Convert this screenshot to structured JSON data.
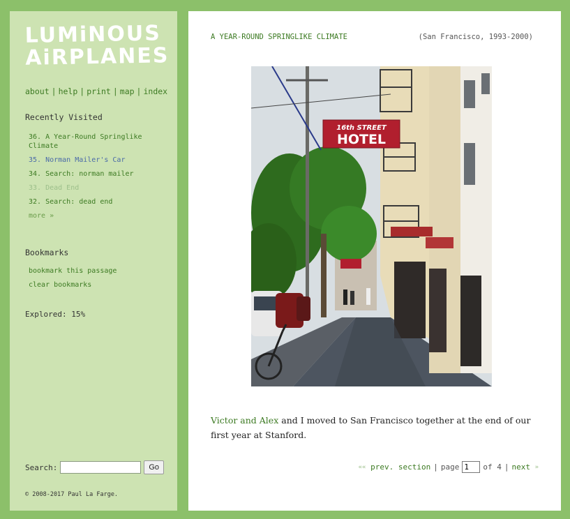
{
  "logo": {
    "line1": "LUMiNOUS",
    "line2": "AiRPLANES"
  },
  "nav": {
    "about": "about",
    "help": "help",
    "print": "print",
    "map": "map",
    "index": "index",
    "separator": "|"
  },
  "recently_visited": {
    "heading": "Recently Visited",
    "items": [
      "36. A Year-Round Springlike Climate",
      "35. Norman Mailer's Car",
      "34. Search: norman mailer",
      "33. Dead End",
      "32. Search: dead end"
    ],
    "more": "more »"
  },
  "bookmarks": {
    "heading": "Bookmarks",
    "bookmark_this": "bookmark this passage",
    "clear": "clear bookmarks"
  },
  "explored": "Explored: 15%",
  "search": {
    "label": "Search:",
    "value": "",
    "button": "Go"
  },
  "copyright": "© 2008-2017 Paul La Farge.",
  "section": {
    "title": "A YEAR-ROUND SPRINGLIKE CLIMATE",
    "place_date": "(San Francisco, 1993-2000)"
  },
  "photo": {
    "sign_line1": "16th STREET",
    "sign_line2": "HOTEL"
  },
  "body": {
    "link_text": "Victor and Alex",
    "text": " and I moved to San Francisco together at the end of our first year at Stanford."
  },
  "pager": {
    "prev": "prev. section",
    "page_label": "page",
    "page_value": "1",
    "of_text": "of 4",
    "next": "next",
    "prev_arrow": "««",
    "next_arrow": "»",
    "separator": "|"
  },
  "colors": {
    "frame": "#8cc06a",
    "sidebar": "#cde3b2",
    "link": "#3c7a22"
  }
}
